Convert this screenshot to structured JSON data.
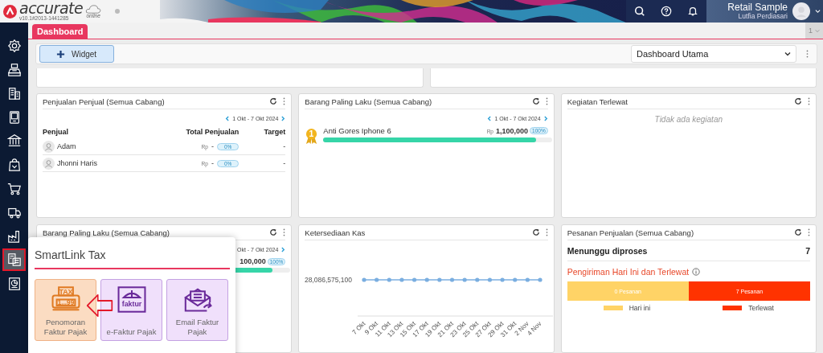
{
  "header": {
    "logo": "accurate",
    "logo_sub": "online",
    "version": "v10.1#2013-1441285",
    "user": {
      "company": "Retail Sample",
      "name": "Lutfia Perdiasari"
    }
  },
  "sidebar": {
    "items": [
      {
        "kind": "settings",
        "selected": false
      },
      {
        "kind": "register",
        "selected": false
      },
      {
        "kind": "building",
        "selected": false
      },
      {
        "kind": "device",
        "selected": false
      },
      {
        "kind": "bank",
        "selected": false
      },
      {
        "kind": "bag",
        "selected": false
      },
      {
        "kind": "cart",
        "selected": false
      },
      {
        "kind": "truck",
        "selected": false
      },
      {
        "kind": "factory",
        "selected": false
      },
      {
        "kind": "tax",
        "selected": true
      },
      {
        "kind": "report",
        "selected": false
      }
    ]
  },
  "tabs": [
    {
      "label": "Dashboard",
      "selected": true
    }
  ],
  "page_selector": "1",
  "toolbar": {
    "widget_button": "Widget",
    "dashboard_select": "Dashboard Utama"
  },
  "widgets": [
    {
      "kind": "sellers",
      "title": "Penjualan Penjual (Semua Cabang)",
      "date_range": "1 Okt - 7 Okt 2024",
      "columns": [
        "Penjual",
        "Total Penjualan",
        "Target"
      ],
      "rows": [
        {
          "name": "Adam",
          "currency": "Rp",
          "amount": "-",
          "badge": "0%",
          "target": "-"
        },
        {
          "name": "Jhonni Haris",
          "currency": "Rp",
          "amount": "-",
          "badge": "0%",
          "target": "-"
        }
      ]
    },
    {
      "kind": "best_selling",
      "title": "Barang Paling Laku (Semua Cabang)",
      "date_range": "1 Okt - 7 Okt 2024",
      "items": [
        {
          "rank": "1",
          "name": "Anti Gores Iphone 6",
          "currency": "Rp",
          "amount": "1,100,000",
          "badge": "100%",
          "level": 0.93
        }
      ]
    },
    {
      "kind": "activities",
      "title": "Kegiatan Terlewat",
      "empty_text": "Tidak ada kegiatan"
    },
    {
      "kind": "best_selling_partial",
      "title": "Barang Paling Laku (Semua Cabang)",
      "date_range": "Okt - 7 Okt 2024",
      "items": [
        {
          "amount": "100,000",
          "badge": "100%",
          "level": 0.93
        }
      ]
    },
    {
      "kind": "cash",
      "title": "Ketersediaan Kas",
      "y_label": "28,086,575,100",
      "x_labels": [
        "7 Okt",
        "9 Okt",
        "11 Okt",
        "13 Okt",
        "15 Okt",
        "17 Okt",
        "19 Okt",
        "21 Okt",
        "23 Okt",
        "25 Okt",
        "27 Okt",
        "29 Okt",
        "31 Okt",
        "2 Nov",
        "4 Nov"
      ]
    },
    {
      "kind": "orders",
      "title": "Pesanan Penjualan (Semua Cabang)",
      "waiting_label": "Menunggu diproses",
      "waiting_count": "7",
      "delivery_title": "Pengiriman Hari Ini dan Terlewat",
      "segments": [
        {
          "label": "0 Pesanan",
          "color": "#ffd366"
        },
        {
          "label": "7 Pesanan",
          "color": "#ff3300"
        }
      ],
      "legend": [
        {
          "label": "Hari ini",
          "color": "#ffd366"
        },
        {
          "label": "Terlewat",
          "color": "#ff3300"
        }
      ]
    }
  ],
  "popup": {
    "title": "SmartLink Tax",
    "tiles": [
      {
        "kind": "numbering",
        "label": "Penomoran Faktur Pajak",
        "icon_text": [
          "TAX",
          "1...99"
        ],
        "selected": true
      },
      {
        "kind": "efaktur",
        "label": "e-Faktur Pajak",
        "icon_text": [
          "faktur"
        ],
        "selected": false
      },
      {
        "kind": "email",
        "label": "Email Faktur Pajak",
        "selected": false
      }
    ]
  }
}
